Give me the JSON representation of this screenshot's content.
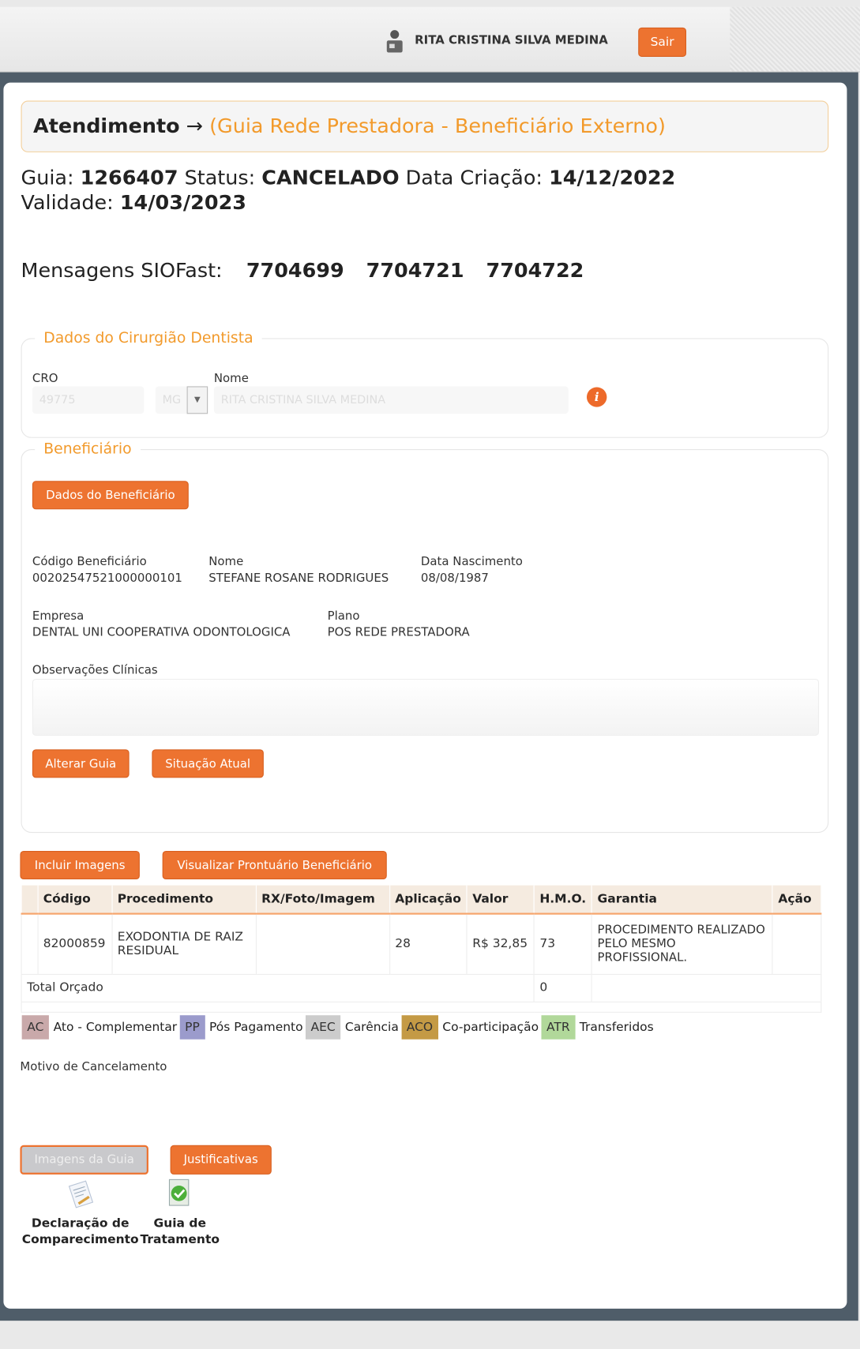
{
  "header": {
    "user_name": "RITA CRISTINA SILVA MEDINA",
    "logout_label": "Sair"
  },
  "title": {
    "main": "Atendimento",
    "arrow": "→",
    "sub": "(Guia Rede Prestadora - Beneficiário Externo)"
  },
  "guia": {
    "guia_label": "Guia:",
    "guia_value": "1266407",
    "status_label": "Status:",
    "status_value": "CANCELADO",
    "criacao_label": "Data Criação:",
    "criacao_value": "14/12/2022",
    "validade_label": "Validade:",
    "validade_value": "14/03/2023"
  },
  "siofast": {
    "label": "Mensagens SIOFast:",
    "messages": [
      "7704699",
      "7704721",
      "7704722"
    ]
  },
  "dentista": {
    "legend": "Dados do Cirurgião Dentista",
    "cro_label": "CRO",
    "cro_value": "49775",
    "uf_value": "MG",
    "nome_label": "Nome",
    "nome_value": "RITA CRISTINA SILVA MEDINA"
  },
  "beneficiario": {
    "legend": "Beneficiário",
    "dados_button": "Dados do Beneficiário",
    "codigo_label": "Código Beneficiário",
    "codigo_value": "00202547521000000101",
    "nome_label": "Nome",
    "nome_value": "STEFANE ROSANE RODRIGUES",
    "nasc_label": "Data Nascimento",
    "nasc_value": "08/08/1987",
    "empresa_label": "Empresa",
    "empresa_value": "DENTAL UNI COOPERATIVA ODONTOLOGICA",
    "plano_label": "Plano",
    "plano_value": "POS REDE PRESTADORA",
    "obs_label": "Observações Clínicas",
    "alterar_button": "Alterar Guia",
    "situacao_button": "Situação Atual"
  },
  "actions": {
    "incluir": "Incluir Imagens",
    "visualizar": "Visualizar Prontuário Beneficiário"
  },
  "table": {
    "headers": [
      "Código",
      "Procedimento",
      "RX/Foto/Imagem",
      "Aplicação",
      "Valor",
      "H.M.O.",
      "Garantia",
      "Ação"
    ],
    "rows": [
      {
        "codigo": "82000859",
        "procedimento": "EXODONTIA DE RAIZ RESIDUAL",
        "rx": "",
        "aplicacao": "28",
        "valor": "R$ 32,85",
        "hmo": "73",
        "garantia": "PROCEDIMENTO REALIZADO PELO MESMO PROFISSIONAL.",
        "acao": ""
      }
    ],
    "total_label": "Total Orçado",
    "total_hmo": "0"
  },
  "legend": [
    {
      "code": "AC",
      "label": "Ato - Complementar",
      "color": "#c9a9aa"
    },
    {
      "code": "PP",
      "label": "Pós Pagamento",
      "color": "#9b9bcc"
    },
    {
      "code": "AEC",
      "label": "Carência",
      "color": "#cccccc"
    },
    {
      "code": "ACO",
      "label": "Co-participação",
      "color": "#c49a45"
    },
    {
      "code": "ATR",
      "label": "Transferidos",
      "color": "#b1d89a"
    }
  ],
  "cancel": {
    "label": "Motivo de Cancelamento"
  },
  "bottom": {
    "imagens": "Imagens da Guia",
    "justificativas": "Justificativas",
    "declaracao": "Declaração de Comparecimento",
    "guia_tratamento": "Guia de Tratamento"
  }
}
